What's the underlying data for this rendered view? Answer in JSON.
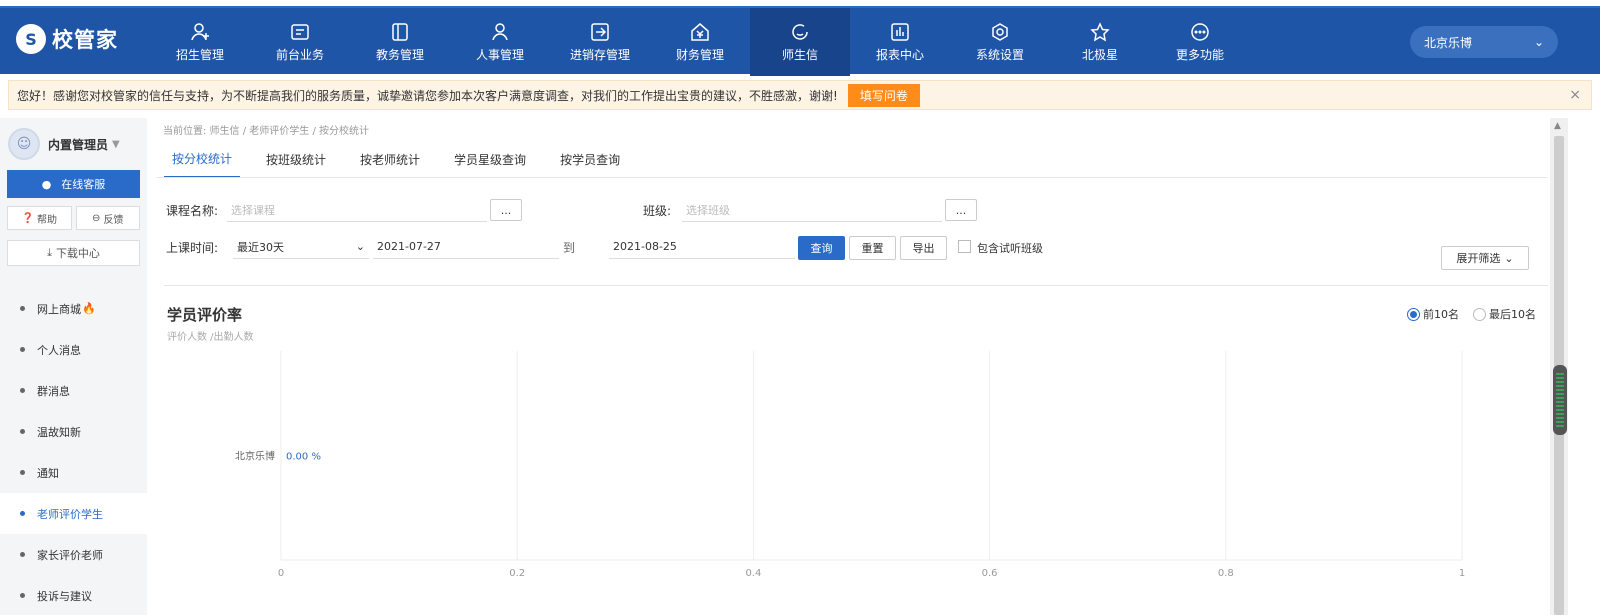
{
  "app": {
    "logo_text": "校管家",
    "logo_icon": "logo-icon"
  },
  "nav": [
    {
      "label": "招生管理",
      "icon": "enroll-icon"
    },
    {
      "label": "前台业务",
      "icon": "desk-icon"
    },
    {
      "label": "教务管理",
      "icon": "book-icon"
    },
    {
      "label": "人事管理",
      "icon": "person-icon"
    },
    {
      "label": "进销存管理",
      "icon": "inventory-icon"
    },
    {
      "label": "财务管理",
      "icon": "finance-icon"
    },
    {
      "label": "师生信",
      "icon": "message-icon",
      "active": true
    },
    {
      "label": "报表中心",
      "icon": "report-icon"
    },
    {
      "label": "系统设置",
      "icon": "settings-icon"
    },
    {
      "label": "北极星",
      "icon": "star-icon"
    },
    {
      "label": "更多功能",
      "icon": "more-icon"
    }
  ],
  "campus": "北京乐博",
  "notice": {
    "text": "您好！感谢您对校管家的信任与支持，为不断提高我们的服务质量，诚挚邀请您参加本次客户满意度调查，对我们的工作提出宝贵的建议，不胜感激，谢谢!",
    "button": "填写问卷",
    "close": "×"
  },
  "sidebar": {
    "user_name": "内置管理员",
    "service": "在线客服",
    "help": "帮助",
    "feedback": "反馈",
    "download": "下载中心",
    "items": [
      {
        "label": "网上商城",
        "hot": true
      },
      {
        "label": "个人消息"
      },
      {
        "label": "群消息"
      },
      {
        "label": "温故知新"
      },
      {
        "label": "通知"
      },
      {
        "label": "老师评价学生",
        "active": true
      },
      {
        "label": "家长评价老师"
      },
      {
        "label": "投诉与建议"
      }
    ]
  },
  "breadcrumb": "当前位置: 师生信 / 老师评价学生 / 按分校统计",
  "tabs": [
    {
      "label": "按分校统计",
      "active": true
    },
    {
      "label": "按班级统计"
    },
    {
      "label": "按老师统计"
    },
    {
      "label": "学员星级查询"
    },
    {
      "label": "按学员查询"
    }
  ],
  "filters": {
    "course_label": "课程名称:",
    "course_placeholder": "选择课程",
    "class_label": "班级:",
    "class_placeholder": "选择班级",
    "dots": "...",
    "time_label": "上课时间:",
    "period": "最近30天",
    "date_from": "2021-07-27",
    "to": "到",
    "date_to": "2021-08-25",
    "query": "查询",
    "reset": "重置",
    "export": "导出",
    "include_trial": "包含试听班级",
    "expand": "展开筛选"
  },
  "chart_section": {
    "title": "学员评价率",
    "subtitle": "评价人数 /出勤人数",
    "radio_top": "前10名",
    "radio_bottom": "最后10名",
    "selected": "top"
  },
  "chart_data": {
    "type": "bar",
    "orientation": "horizontal",
    "categories": [
      "北京乐博"
    ],
    "values": [
      0
    ],
    "data_labels": [
      "0.00 %"
    ],
    "xlim": [
      0,
      1
    ],
    "xticks": [
      "0",
      "0.2",
      "0.4",
      "0.6",
      "0.8",
      "1"
    ],
    "grid": true
  },
  "colors": {
    "primary": "#2a6ac9",
    "nav_bg": "#1f55a6",
    "notice_btn": "#ff8c1a",
    "hot": "#ff3b1f"
  }
}
